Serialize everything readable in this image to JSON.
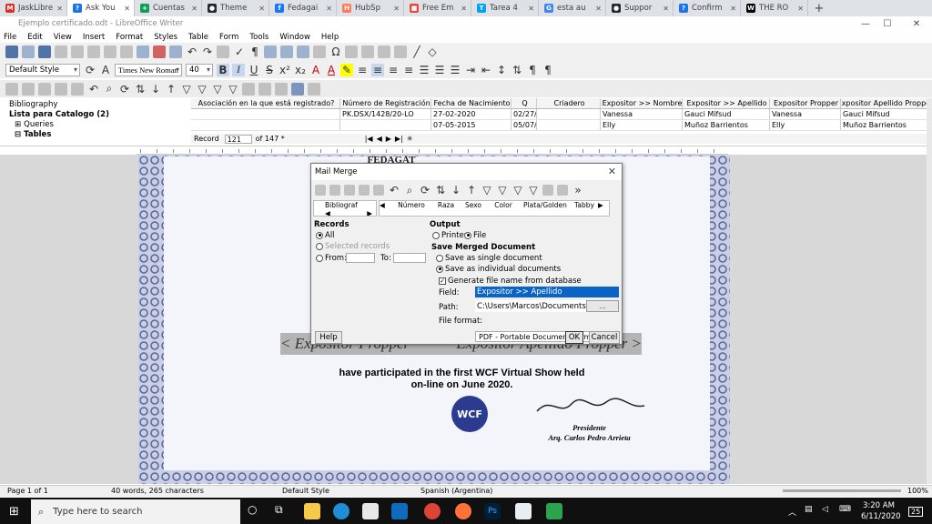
{
  "browser_tabs": [
    {
      "label": "JaskLibre",
      "icon": "gmail-icon",
      "color": "#d93025",
      "glyph": "M"
    },
    {
      "label": "Ask You",
      "icon": "question-icon",
      "color": "#1a73e8",
      "glyph": "?",
      "active": true
    },
    {
      "label": "Cuentas",
      "icon": "sheets-icon",
      "color": "#0f9d58",
      "glyph": "+"
    },
    {
      "label": "Theme",
      "icon": "github-icon",
      "color": "#24292e",
      "glyph": "●"
    },
    {
      "label": "Fedagai",
      "icon": "facebook-icon",
      "color": "#1877f2",
      "glyph": "f"
    },
    {
      "label": "HubSp",
      "icon": "hubspot-icon",
      "color": "#ff7a59",
      "glyph": "H"
    },
    {
      "label": "Free Em",
      "icon": "bookmark-icon",
      "color": "#e8453c",
      "glyph": "■"
    },
    {
      "label": "Tarea 4",
      "icon": "app-icon",
      "color": "#00a2ed",
      "glyph": "T"
    },
    {
      "label": "esta au",
      "icon": "google-icon",
      "color": "#4285f4",
      "glyph": "G"
    },
    {
      "label": "Suppor",
      "icon": "github-icon",
      "color": "#24292e",
      "glyph": "●"
    },
    {
      "label": "Confirm",
      "icon": "question-icon",
      "color": "#1a73e8",
      "glyph": "?"
    },
    {
      "label": "THE RO",
      "icon": "wikipedia-icon",
      "color": "#000000",
      "glyph": "W"
    }
  ],
  "window": {
    "title": "Ejemplo certificado.odt - LibreOffice Writer"
  },
  "menu": [
    "File",
    "Edit",
    "View",
    "Insert",
    "Format",
    "Styles",
    "Table",
    "Form",
    "Tools",
    "Window",
    "Help"
  ],
  "formatting": {
    "paragraph_style": "Default Style",
    "font_name": "Times New Roman",
    "font_size": "40"
  },
  "data_tree": [
    "Bibliography",
    "Lista para Catalogo (2)",
    "Queries",
    "Tables"
  ],
  "grid": {
    "columns": [
      "Asociación en la que está registrado?",
      "Número de Registración",
      "Fecha de Nacimiento",
      "Q",
      "Criadero",
      "Expositor >> Nombre",
      "Expositor >> Apellido",
      "Expositor Propper",
      "Expositor Apellido Propper"
    ],
    "rows": [
      [
        "",
        "PK.DSX/1428/20-LO",
        "27-02-2020",
        "02/27/",
        "",
        "Vanessa",
        "Gauci Mifsud",
        "Vanessa",
        "Gauci Mifsud"
      ],
      [
        "",
        "",
        "07-05-2015",
        "05/07/",
        "",
        "Elly",
        "Muñoz Barrientos",
        "Elly",
        "Muñoz Barrientos"
      ]
    ],
    "record_label": "Record",
    "record_value": "121",
    "record_total": "of 147 *"
  },
  "document": {
    "banner_text": "FEDAGAT",
    "left_scroll": "< Expositor Propper",
    "right_scroll": "Expositor Apellido Propper >",
    "line1": "have participated in the first WCF Virtual Show held",
    "line2": "on-line on June 2020.",
    "logo_text": "WCF",
    "signer_role": "Presidente",
    "signer_name": "Arq. Carlos Pedro Arrieta"
  },
  "dialog": {
    "title": "Mail Merge",
    "mini_columns": [
      "Bibliograf",
      "Número",
      "Raza",
      "Sexo",
      "Color",
      "Plata/Golden",
      "Tabby"
    ],
    "records_label": "Records",
    "all_label": "All",
    "selected_label": "Selected records",
    "from_label": "From:",
    "to_label": "To:",
    "output_label": "Output",
    "printer_label": "Printer",
    "file_label": "File",
    "save_merged_label": "Save Merged Document",
    "single_doc_label": "Save as single document",
    "individual_docs_label": "Save as individual documents",
    "generate_label": "Generate file name from database",
    "field_label": "Field:",
    "field_value": "Expositor >> Apellido",
    "path_label": "Path:",
    "path_value": "C:\\Users\\Marcos\\Documents",
    "path_button": "...",
    "format_label": "File format:",
    "format_value": "PDF - Portable Document Format",
    "help_label": "Help",
    "ok_label": "OK",
    "cancel_label": "Cancel"
  },
  "statusbar": {
    "page": "Page 1 of 1",
    "words": "40 words, 265 characters",
    "style": "Default Style",
    "language": "Spanish (Argentina)",
    "zoom": "100%"
  },
  "taskbar": {
    "search_placeholder": "Type here to search",
    "time": "3:20 AM",
    "date": "6/11/2020",
    "notification_count": "25",
    "ps_label": "Ps"
  }
}
